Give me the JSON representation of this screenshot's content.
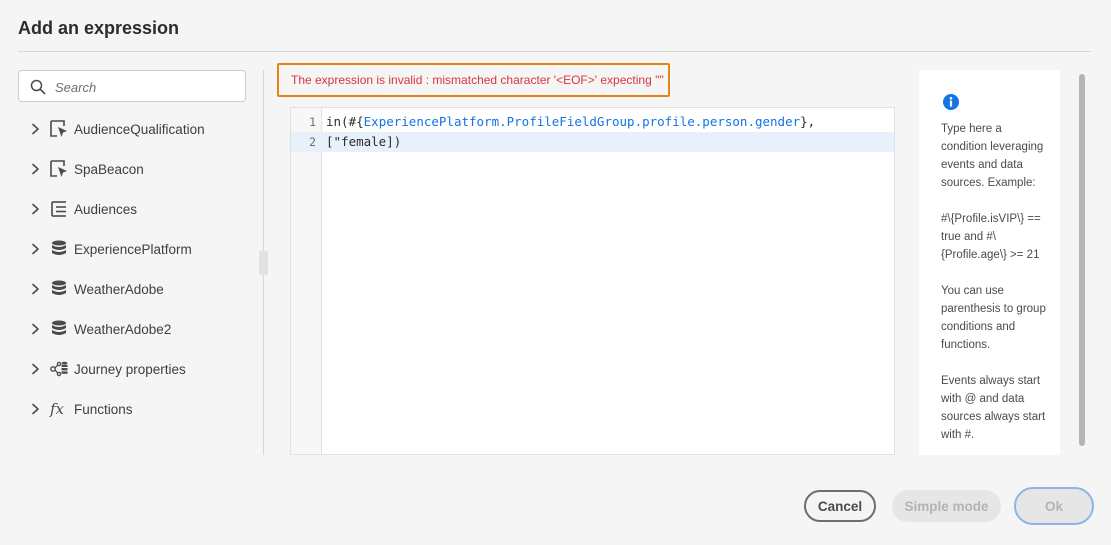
{
  "dialog": {
    "title": "Add an expression"
  },
  "search": {
    "placeholder": "Search",
    "value": ""
  },
  "tree": [
    {
      "label": "AudienceQualification",
      "icon": "event-cursor-icon"
    },
    {
      "label": "SpaBeacon",
      "icon": "event-cursor-icon"
    },
    {
      "label": "Audiences",
      "icon": "list-tree-icon"
    },
    {
      "label": "ExperiencePlatform",
      "icon": "database-icon"
    },
    {
      "label": "WeatherAdobe",
      "icon": "database-icon"
    },
    {
      "label": "WeatherAdobe2",
      "icon": "database-icon"
    },
    {
      "label": "Journey properties",
      "icon": "journey-properties-icon"
    },
    {
      "label": "Functions",
      "icon": "function-icon"
    }
  ],
  "error": {
    "message": "The expression is invalid : mismatched character '<EOF>' expecting '\"'"
  },
  "editor": {
    "lines": [
      {
        "number": "1",
        "prefix": "in(#{",
        "path": "ExperiencePlatform.ProfileFieldGroup.profile.person.gender",
        "suffix": "},"
      },
      {
        "number": "2",
        "code": "[\"female])"
      }
    ]
  },
  "help": {
    "text": "Type here a condition leveraging events and data sources. Example:\n\n#\\{Profile.isVIP\\} == true and #\\{Profile.age\\} >= 21\n\nYou can use parenthesis to group conditions and functions.\n\nEvents always start with @ and data sources always start with #."
  },
  "footer": {
    "cancel_label": "Cancel",
    "simple_mode_label": "Simple mode",
    "ok_label": "Ok"
  },
  "colors": {
    "accent": "#1473e6",
    "error_text": "#d7373f",
    "error_border": "#e68619"
  }
}
